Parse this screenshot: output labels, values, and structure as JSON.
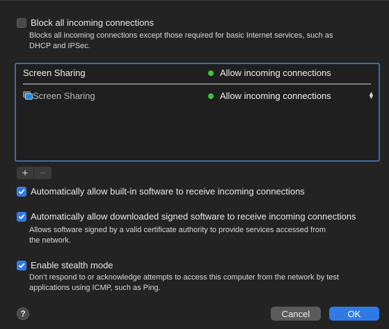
{
  "block_all": {
    "label": "Block all incoming connections",
    "checked": false,
    "description_line1": "Blocks all incoming connections except those required for basic Internet services, such as",
    "description_line2": "DHCP and IPSec."
  },
  "table": {
    "header": {
      "app": "Screen Sharing",
      "status": "Allow incoming connections",
      "status_color": "#3cc63c"
    },
    "rows": [
      {
        "app": "Screen Sharing",
        "icon": "screen-sharing-icon",
        "status": "Allow incoming connections",
        "status_color": "#3cc63c"
      }
    ]
  },
  "table_controls": {
    "add": "+",
    "remove": "−"
  },
  "auto_builtin": {
    "label": "Automatically allow built-in software to receive incoming connections",
    "checked": true
  },
  "auto_signed": {
    "label": "Automatically allow downloaded signed software to receive incoming connections",
    "checked": true,
    "description_line1": "Allows software signed by a valid certificate authority to provide services accessed from",
    "description_line2": "the network."
  },
  "stealth": {
    "label": "Enable stealth mode",
    "checked": true,
    "description_line1": "Don’t respond to or acknowledge attempts to access this computer from the network by test",
    "description_line2": "applications using ICMP, such as Ping."
  },
  "footer": {
    "help": "?",
    "cancel": "Cancel",
    "ok": "OK"
  },
  "colors": {
    "accent": "#2f7ae5",
    "table_border": "#3f6e9f"
  }
}
